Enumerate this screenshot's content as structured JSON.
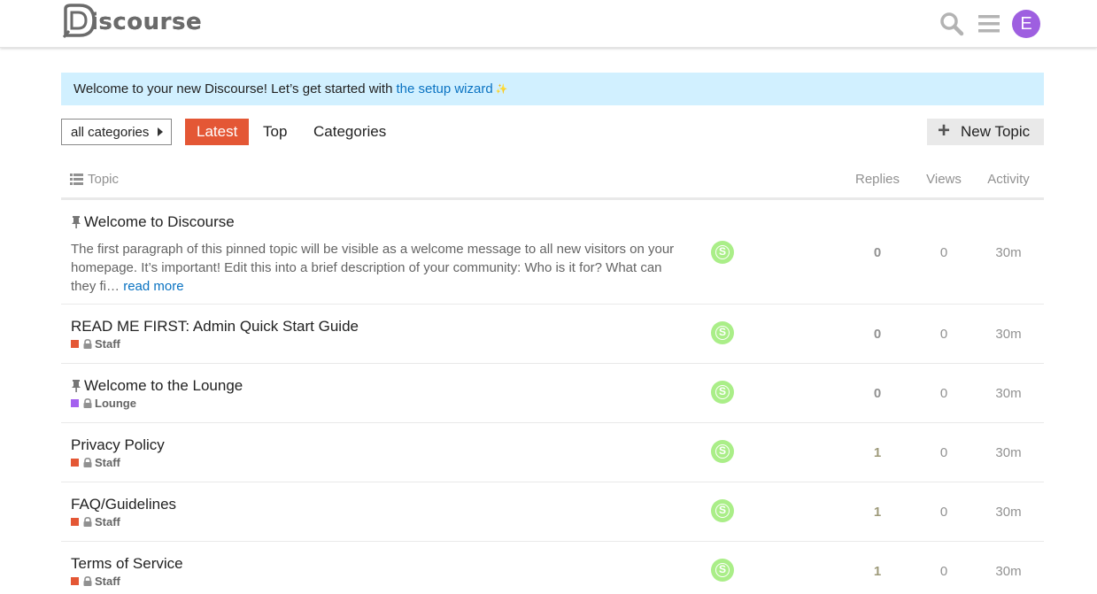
{
  "header": {
    "logo_text": "iscourse",
    "avatar_letter": "E",
    "avatar_color": "#9e5fe0"
  },
  "banner": {
    "text": "Welcome to your new Discourse! Let’s get started with",
    "link": "the setup wizard",
    "sparkle": "✨"
  },
  "nav": {
    "category_dropdown": "all categories",
    "tabs": [
      {
        "label": "Latest",
        "active": true
      },
      {
        "label": "Top",
        "active": false
      },
      {
        "label": "Categories",
        "active": false
      }
    ],
    "new_topic_label": "New Topic"
  },
  "table": {
    "headers": {
      "topic": "Topic",
      "replies": "Replies",
      "views": "Views",
      "activity": "Activity"
    },
    "rows": [
      {
        "title": "Welcome to Discourse",
        "pinned": true,
        "excerpt": "The first paragraph of this pinned topic will be visible as a welcome message to all new visitors on your homepage. It’s important! Edit this into a brief description of your community: Who is it for? What can they fi…",
        "read_more": "read more",
        "category": "",
        "poster": "S",
        "replies": "0",
        "views": "0",
        "activity": "30m"
      },
      {
        "title": "READ ME FIRST: Admin Quick Start Guide",
        "pinned": false,
        "category": "Staff",
        "category_color": "#e45735",
        "poster": "S",
        "replies": "0",
        "views": "0",
        "activity": "30m"
      },
      {
        "title": "Welcome to the Lounge",
        "pinned": true,
        "category": "Lounge",
        "category_color": "#a461ef",
        "poster": "S",
        "replies": "0",
        "views": "0",
        "activity": "30m"
      },
      {
        "title": "Privacy Policy",
        "pinned": false,
        "category": "Staff",
        "category_color": "#e45735",
        "poster": "S",
        "replies": "1",
        "views": "0",
        "activity": "30m"
      },
      {
        "title": "FAQ/Guidelines",
        "pinned": false,
        "category": "Staff",
        "category_color": "#e45735",
        "poster": "S",
        "replies": "1",
        "views": "0",
        "activity": "30m"
      },
      {
        "title": "Terms of Service",
        "pinned": false,
        "category": "Staff",
        "category_color": "#e45735",
        "poster": "S",
        "replies": "1",
        "views": "0",
        "activity": "30m"
      }
    ]
  }
}
